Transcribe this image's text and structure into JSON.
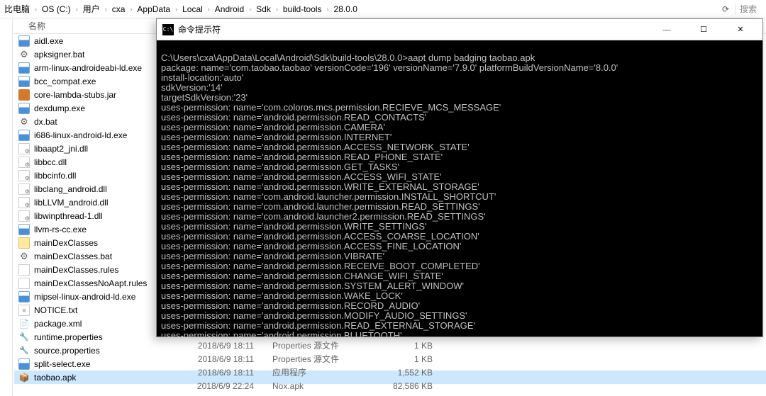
{
  "breadcrumb": {
    "items": [
      "比电脑",
      "OS (C:)",
      "用户",
      "cxa",
      "AppData",
      "Local",
      "Android",
      "Sdk",
      "build-tools",
      "28.0.0"
    ],
    "search_placeholder": "搜索"
  },
  "columns": {
    "name": "名称"
  },
  "files": [
    {
      "name": "aidl.exe",
      "icon": "exe"
    },
    {
      "name": "apksigner.bat",
      "icon": "bat"
    },
    {
      "name": "arm-linux-androideabi-ld.exe",
      "icon": "exe"
    },
    {
      "name": "bcc_compat.exe",
      "icon": "exe"
    },
    {
      "name": "core-lambda-stubs.jar",
      "icon": "jar"
    },
    {
      "name": "dexdump.exe",
      "icon": "exe"
    },
    {
      "name": "dx.bat",
      "icon": "bat"
    },
    {
      "name": "i686-linux-android-ld.exe",
      "icon": "exe"
    },
    {
      "name": "libaapt2_jni.dll",
      "icon": "dll"
    },
    {
      "name": "libbcc.dll",
      "icon": "dll"
    },
    {
      "name": "libbcinfo.dll",
      "icon": "dll"
    },
    {
      "name": "libclang_android.dll",
      "icon": "dll"
    },
    {
      "name": "libLLVM_android.dll",
      "icon": "dll"
    },
    {
      "name": "libwinpthread-1.dll",
      "icon": "dll"
    },
    {
      "name": "llvm-rs-cc.exe",
      "icon": "exe"
    },
    {
      "name": "mainDexClasses",
      "icon": "folder"
    },
    {
      "name": "mainDexClasses.bat",
      "icon": "bat"
    },
    {
      "name": "mainDexClasses.rules",
      "icon": "rules"
    },
    {
      "name": "mainDexClassesNoAapt.rules",
      "icon": "rules"
    },
    {
      "name": "mipsel-linux-android-ld.exe",
      "icon": "exe"
    },
    {
      "name": "NOTICE.txt",
      "icon": "txt"
    },
    {
      "name": "package.xml",
      "icon": "xml"
    },
    {
      "name": "runtime.properties",
      "icon": "prop"
    },
    {
      "name": "source.properties",
      "icon": "prop"
    },
    {
      "name": "split-select.exe",
      "icon": "exe"
    },
    {
      "name": "taobao.apk",
      "icon": "apk",
      "selected": true
    }
  ],
  "details": [
    {
      "date": "2018/6/9 18:11",
      "type": "Properties 源文件",
      "size": "1 KB"
    },
    {
      "date": "2018/6/9 18:11",
      "type": "Properties 源文件",
      "size": "1 KB"
    },
    {
      "date": "2018/6/9 18:11",
      "type": "应用程序",
      "size": "1,552 KB"
    },
    {
      "date": "2018/6/9 22:24",
      "type": "Nox.apk",
      "size": "82,586 KB"
    }
  ],
  "terminal": {
    "title": "命令提示符",
    "lines": [
      "",
      "C:\\Users\\cxa\\AppData\\Local\\Android\\Sdk\\build-tools\\28.0.0>aapt dump badging taobao.apk",
      "package: name='com.taobao.taobao' versionCode='196' versionName='7.9.0' platformBuildVersionName='8.0.0'",
      "install-location:'auto'",
      "sdkVersion:'14'",
      "targetSdkVersion:'23'",
      "uses-permission: name='com.coloros.mcs.permission.RECIEVE_MCS_MESSAGE'",
      "uses-permission: name='android.permission.READ_CONTACTS'",
      "uses-permission: name='android.permission.CAMERA'",
      "uses-permission: name='android.permission.INTERNET'",
      "uses-permission: name='android.permission.ACCESS_NETWORK_STATE'",
      "uses-permission: name='android.permission.READ_PHONE_STATE'",
      "uses-permission: name='android.permission.GET_TASKS'",
      "uses-permission: name='android.permission.ACCESS_WIFI_STATE'",
      "uses-permission: name='android.permission.WRITE_EXTERNAL_STORAGE'",
      "uses-permission: name='com.android.launcher.permission.INSTALL_SHORTCUT'",
      "uses-permission: name='com.android.launcher.permission.READ_SETTINGS'",
      "uses-permission: name='com.android.launcher2.permission.READ_SETTINGS'",
      "uses-permission: name='android.permission.WRITE_SETTINGS'",
      "uses-permission: name='android.permission.ACCESS_COARSE_LOCATION'",
      "uses-permission: name='android.permission.ACCESS_FINE_LOCATION'",
      "uses-permission: name='android.permission.VIBRATE'",
      "uses-permission: name='android.permission.RECEIVE_BOOT_COMPLETED'",
      "uses-permission: name='android.permission.CHANGE_WIFI_STATE'",
      "uses-permission: name='android.permission.SYSTEM_ALERT_WINDOW'",
      "uses-permission: name='android.permission.WAKE_LOCK'",
      "uses-permission: name='android.permission.RECORD_AUDIO'",
      "uses-permission: name='android.permission.MODIFY_AUDIO_SETTINGS'",
      "uses-permission: name='android.permission.READ_EXTERNAL_STORAGE'",
      "uses-permission: name='android.permission.BLUETOOTH'"
    ]
  },
  "winbtn": {
    "min": "—",
    "max": "☐",
    "close": "✕"
  },
  "refresh_icon": "⟳"
}
